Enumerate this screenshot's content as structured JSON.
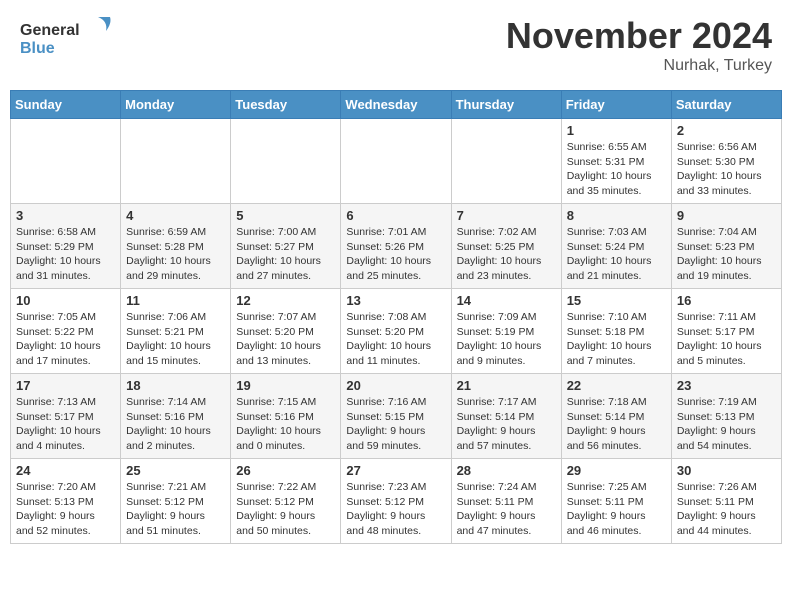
{
  "logo": {
    "text1": "General",
    "text2": "Blue"
  },
  "title": "November 2024",
  "location": "Nurhak, Turkey",
  "days_header": [
    "Sunday",
    "Monday",
    "Tuesday",
    "Wednesday",
    "Thursday",
    "Friday",
    "Saturday"
  ],
  "weeks": [
    [
      {
        "day": "",
        "info": ""
      },
      {
        "day": "",
        "info": ""
      },
      {
        "day": "",
        "info": ""
      },
      {
        "day": "",
        "info": ""
      },
      {
        "day": "",
        "info": ""
      },
      {
        "day": "1",
        "info": "Sunrise: 6:55 AM\nSunset: 5:31 PM\nDaylight: 10 hours\nand 35 minutes."
      },
      {
        "day": "2",
        "info": "Sunrise: 6:56 AM\nSunset: 5:30 PM\nDaylight: 10 hours\nand 33 minutes."
      }
    ],
    [
      {
        "day": "3",
        "info": "Sunrise: 6:58 AM\nSunset: 5:29 PM\nDaylight: 10 hours\nand 31 minutes."
      },
      {
        "day": "4",
        "info": "Sunrise: 6:59 AM\nSunset: 5:28 PM\nDaylight: 10 hours\nand 29 minutes."
      },
      {
        "day": "5",
        "info": "Sunrise: 7:00 AM\nSunset: 5:27 PM\nDaylight: 10 hours\nand 27 minutes."
      },
      {
        "day": "6",
        "info": "Sunrise: 7:01 AM\nSunset: 5:26 PM\nDaylight: 10 hours\nand 25 minutes."
      },
      {
        "day": "7",
        "info": "Sunrise: 7:02 AM\nSunset: 5:25 PM\nDaylight: 10 hours\nand 23 minutes."
      },
      {
        "day": "8",
        "info": "Sunrise: 7:03 AM\nSunset: 5:24 PM\nDaylight: 10 hours\nand 21 minutes."
      },
      {
        "day": "9",
        "info": "Sunrise: 7:04 AM\nSunset: 5:23 PM\nDaylight: 10 hours\nand 19 minutes."
      }
    ],
    [
      {
        "day": "10",
        "info": "Sunrise: 7:05 AM\nSunset: 5:22 PM\nDaylight: 10 hours\nand 17 minutes."
      },
      {
        "day": "11",
        "info": "Sunrise: 7:06 AM\nSunset: 5:21 PM\nDaylight: 10 hours\nand 15 minutes."
      },
      {
        "day": "12",
        "info": "Sunrise: 7:07 AM\nSunset: 5:20 PM\nDaylight: 10 hours\nand 13 minutes."
      },
      {
        "day": "13",
        "info": "Sunrise: 7:08 AM\nSunset: 5:20 PM\nDaylight: 10 hours\nand 11 minutes."
      },
      {
        "day": "14",
        "info": "Sunrise: 7:09 AM\nSunset: 5:19 PM\nDaylight: 10 hours\nand 9 minutes."
      },
      {
        "day": "15",
        "info": "Sunrise: 7:10 AM\nSunset: 5:18 PM\nDaylight: 10 hours\nand 7 minutes."
      },
      {
        "day": "16",
        "info": "Sunrise: 7:11 AM\nSunset: 5:17 PM\nDaylight: 10 hours\nand 5 minutes."
      }
    ],
    [
      {
        "day": "17",
        "info": "Sunrise: 7:13 AM\nSunset: 5:17 PM\nDaylight: 10 hours\nand 4 minutes."
      },
      {
        "day": "18",
        "info": "Sunrise: 7:14 AM\nSunset: 5:16 PM\nDaylight: 10 hours\nand 2 minutes."
      },
      {
        "day": "19",
        "info": "Sunrise: 7:15 AM\nSunset: 5:16 PM\nDaylight: 10 hours\nand 0 minutes."
      },
      {
        "day": "20",
        "info": "Sunrise: 7:16 AM\nSunset: 5:15 PM\nDaylight: 9 hours\nand 59 minutes."
      },
      {
        "day": "21",
        "info": "Sunrise: 7:17 AM\nSunset: 5:14 PM\nDaylight: 9 hours\nand 57 minutes."
      },
      {
        "day": "22",
        "info": "Sunrise: 7:18 AM\nSunset: 5:14 PM\nDaylight: 9 hours\nand 56 minutes."
      },
      {
        "day": "23",
        "info": "Sunrise: 7:19 AM\nSunset: 5:13 PM\nDaylight: 9 hours\nand 54 minutes."
      }
    ],
    [
      {
        "day": "24",
        "info": "Sunrise: 7:20 AM\nSunset: 5:13 PM\nDaylight: 9 hours\nand 52 minutes."
      },
      {
        "day": "25",
        "info": "Sunrise: 7:21 AM\nSunset: 5:12 PM\nDaylight: 9 hours\nand 51 minutes."
      },
      {
        "day": "26",
        "info": "Sunrise: 7:22 AM\nSunset: 5:12 PM\nDaylight: 9 hours\nand 50 minutes."
      },
      {
        "day": "27",
        "info": "Sunrise: 7:23 AM\nSunset: 5:12 PM\nDaylight: 9 hours\nand 48 minutes."
      },
      {
        "day": "28",
        "info": "Sunrise: 7:24 AM\nSunset: 5:11 PM\nDaylight: 9 hours\nand 47 minutes."
      },
      {
        "day": "29",
        "info": "Sunrise: 7:25 AM\nSunset: 5:11 PM\nDaylight: 9 hours\nand 46 minutes."
      },
      {
        "day": "30",
        "info": "Sunrise: 7:26 AM\nSunset: 5:11 PM\nDaylight: 9 hours\nand 44 minutes."
      }
    ]
  ]
}
